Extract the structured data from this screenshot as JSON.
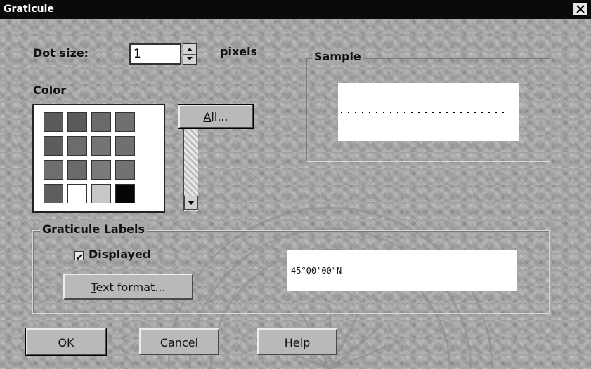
{
  "window": {
    "title": "Graticule"
  },
  "dot_size": {
    "label": "Dot size:",
    "value": "1",
    "unit": "pixels"
  },
  "color": {
    "label": "Color",
    "swatches": [
      "#5a5a5a",
      "#5a5a5a",
      "#6a6a6a",
      "#707070",
      "#5c5c5c",
      "#6c6c6c",
      "#747474",
      "#707070",
      "#6e6e6e",
      "#6a6a6a",
      "#7a7a7a",
      "#727272",
      "#5e5e5e",
      "#ffffff",
      "#c8c8c8",
      "#050505"
    ],
    "all_button": {
      "hotkey": "A",
      "rest": "ll..."
    }
  },
  "sample": {
    "title": "Sample"
  },
  "graticule_labels": {
    "title": "Graticule Labels",
    "displayed_label": "Displayed",
    "displayed_checked": true,
    "text_format_button": {
      "hotkey": "T",
      "rest": "ext format..."
    },
    "preview_text": "45°00'00\"N"
  },
  "buttons": {
    "ok": "OK",
    "cancel": "Cancel",
    "help": "Help"
  }
}
